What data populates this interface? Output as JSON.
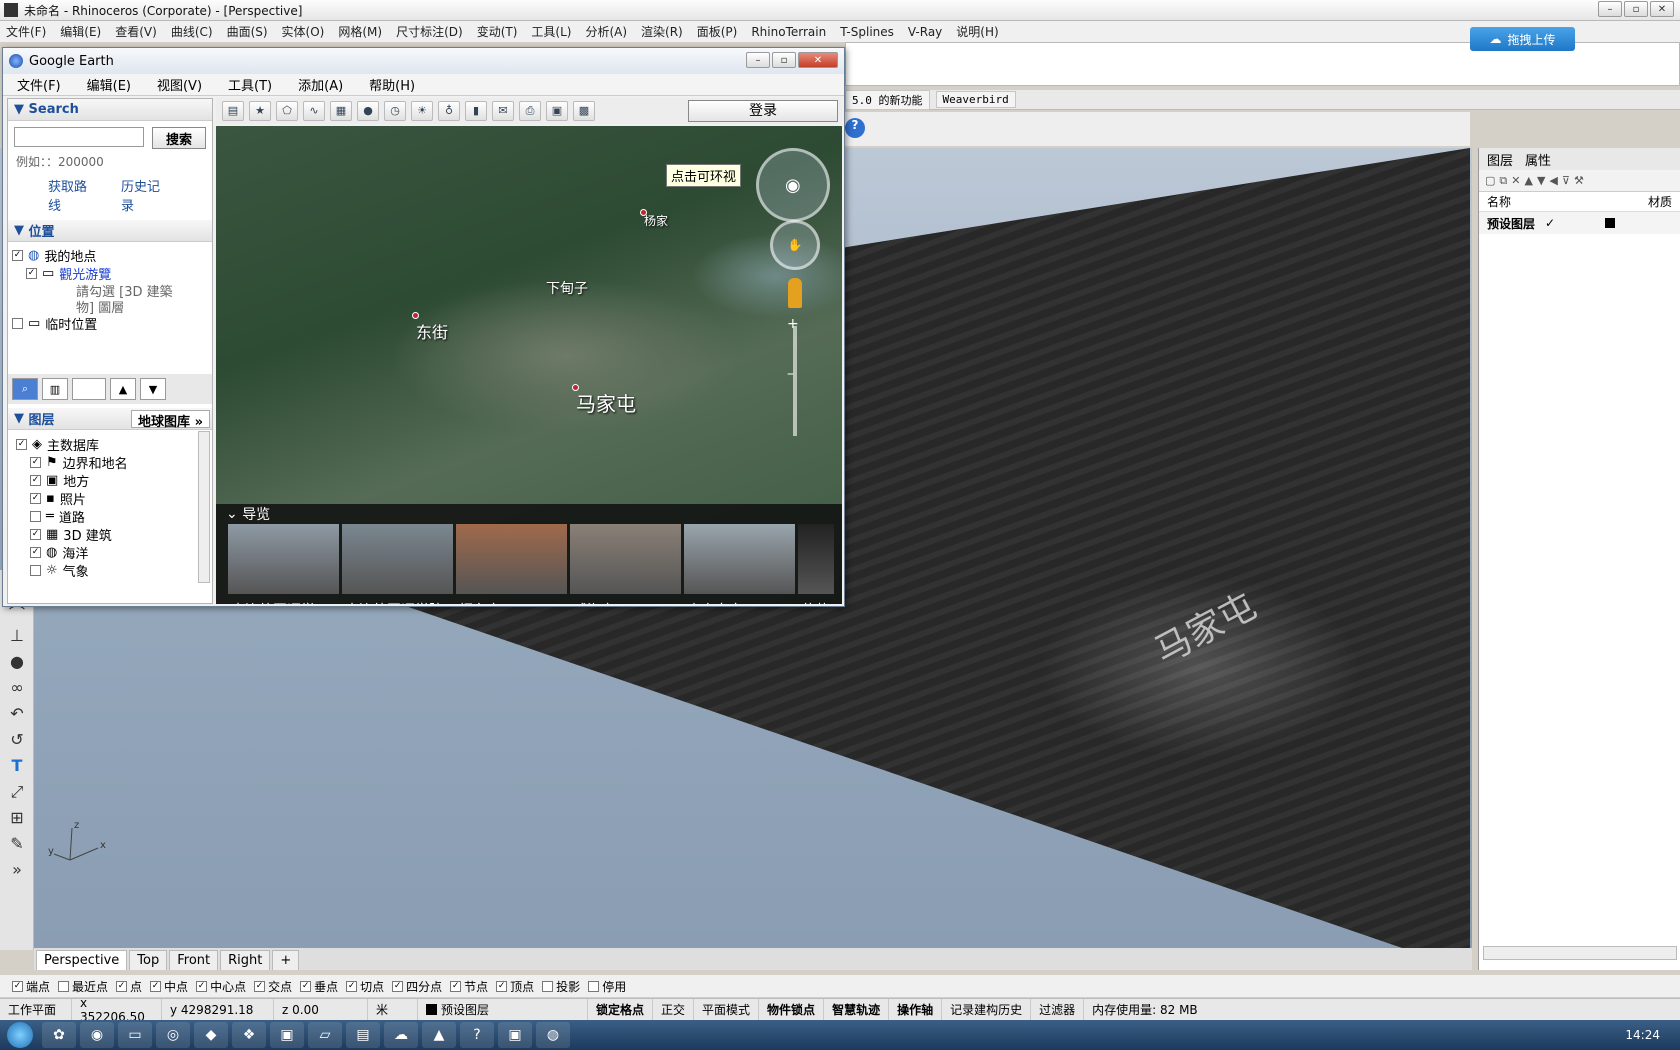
{
  "rhino": {
    "title": "未命名 - Rhinoceros (Corporate) - [Perspective]",
    "menu": [
      "文件(F)",
      "编辑(E)",
      "查看(V)",
      "曲线(C)",
      "曲面(S)",
      "实体(O)",
      "网格(M)",
      "尺寸标注(D)",
      "变动(T)",
      "工具(L)",
      "分析(A)",
      "渲染(R)",
      "面板(P)",
      "RhinoTerrain",
      "T-Splines",
      "V-Ray",
      "说明(H)"
    ],
    "upload_button": "拖拽上传",
    "toolbar_tabs": [
      "5.0 的新功能",
      "Weaverbird"
    ],
    "viewport_tabs": [
      "Perspective",
      "Top",
      "Front",
      "Right"
    ],
    "terrain_label": "马家屯",
    "axis": {
      "x": "x",
      "y": "y",
      "z": "z"
    }
  },
  "layers_panel": {
    "tabs": [
      "图层",
      "属性"
    ],
    "col_name": "名称",
    "col_material": "材质",
    "default_layer": "预设图层",
    "check": "✓"
  },
  "osnap": [
    {
      "label": "端点",
      "checked": true
    },
    {
      "label": "最近点",
      "checked": false
    },
    {
      "label": "点",
      "checked": true
    },
    {
      "label": "中点",
      "checked": true
    },
    {
      "label": "中心点",
      "checked": true
    },
    {
      "label": "交点",
      "checked": true
    },
    {
      "label": "垂点",
      "checked": true
    },
    {
      "label": "切点",
      "checked": true
    },
    {
      "label": "四分点",
      "checked": true
    },
    {
      "label": "节点",
      "checked": true
    },
    {
      "label": "顶点",
      "checked": true
    },
    {
      "label": "投影",
      "checked": false
    },
    {
      "label": "停用",
      "checked": false
    }
  ],
  "status": {
    "cplane": "工作平面",
    "x": "x 352206.50",
    "y": "y 4298291.18",
    "z": "z 0.00",
    "unit": "米",
    "layer": "预设图层",
    "grid_snap": "锁定格点",
    "ortho": "正交",
    "planar": "平面模式",
    "osnap": "物件锁点",
    "smarttrack": "智慧轨迹",
    "gumball": "操作轴",
    "history": "记录建构历史",
    "filter": "过滤器",
    "memory": "内存使用量: 82 MB"
  },
  "taskbar": {
    "clock": "14:24"
  },
  "google_earth": {
    "title": "Google Earth",
    "menu": [
      "文件(F)",
      "编辑(E)",
      "视图(V)",
      "工具(T)",
      "添加(A)",
      "帮助(H)"
    ],
    "search_section": "Search",
    "search_button": "搜索",
    "search_hint": "例如：：200000",
    "link_directions": "获取路线",
    "link_history": "历史记录",
    "places_section": "位置",
    "places": {
      "my_places": "我的地点",
      "sightseeing": "觀光游覽",
      "hint1": "請勾選 [3D 建築",
      "hint2": "物] 圖層",
      "temp": "临时位置"
    },
    "layers_section": "图层",
    "gallery_button": "地球图库",
    "layers": [
      "主数据库",
      "边界和地名",
      "地方",
      "照片",
      "道路",
      "3D 建筑",
      "海洋",
      "气象"
    ],
    "login_button": "登录",
    "tooltip": "点击可环视",
    "map_labels": {
      "a": "杨家",
      "b": "下甸子",
      "c": "东街",
      "d": "马家屯"
    },
    "tour_title": "导览",
    "tours": [
      "大连外国语学…",
      "大连外国语学院",
      "烟台市",
      "威海市",
      "秦皇岛市",
      "葫芦"
    ]
  },
  "colors": {
    "accent": "#1e4f9a",
    "terrain": "#3a3a3a",
    "sky": "#a9b8c9"
  }
}
